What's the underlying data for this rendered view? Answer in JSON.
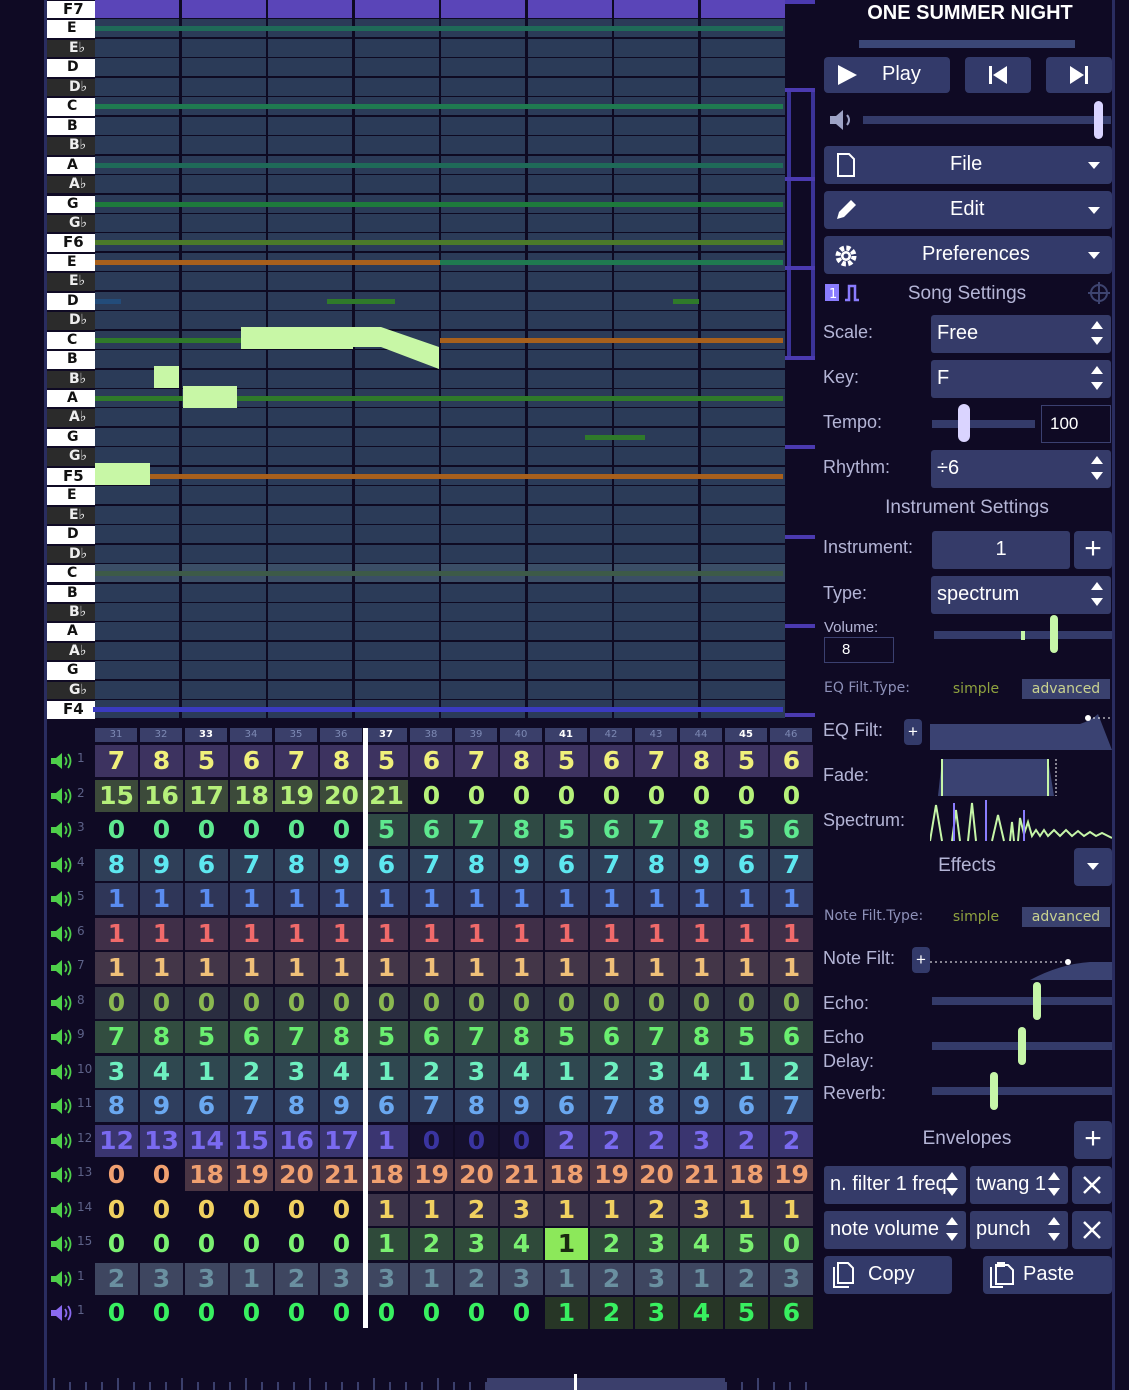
{
  "piano_keys": [
    {
      "label": "F7",
      "kind": "o"
    },
    {
      "label": "E",
      "kind": "w"
    },
    {
      "label": "E♭",
      "kind": "b"
    },
    {
      "label": "D",
      "kind": "w"
    },
    {
      "label": "D♭",
      "kind": "b"
    },
    {
      "label": "C",
      "kind": "w"
    },
    {
      "label": "B",
      "kind": "w"
    },
    {
      "label": "B♭",
      "kind": "b"
    },
    {
      "label": "A",
      "kind": "w"
    },
    {
      "label": "A♭",
      "kind": "b"
    },
    {
      "label": "G",
      "kind": "w"
    },
    {
      "label": "G♭",
      "kind": "b"
    },
    {
      "label": "F6",
      "kind": "o"
    },
    {
      "label": "E",
      "kind": "w"
    },
    {
      "label": "E♭",
      "kind": "b"
    },
    {
      "label": "D",
      "kind": "w"
    },
    {
      "label": "D♭",
      "kind": "b"
    },
    {
      "label": "C",
      "kind": "w"
    },
    {
      "label": "B",
      "kind": "w"
    },
    {
      "label": "B♭",
      "kind": "b"
    },
    {
      "label": "A",
      "kind": "w"
    },
    {
      "label": "A♭",
      "kind": "b"
    },
    {
      "label": "G",
      "kind": "w"
    },
    {
      "label": "G♭",
      "kind": "b"
    },
    {
      "label": "F5",
      "kind": "o"
    },
    {
      "label": "E",
      "kind": "w"
    },
    {
      "label": "E♭",
      "kind": "b"
    },
    {
      "label": "D",
      "kind": "w"
    },
    {
      "label": "D♭",
      "kind": "b"
    },
    {
      "label": "C",
      "kind": "w"
    },
    {
      "label": "B",
      "kind": "w"
    },
    {
      "label": "B♭",
      "kind": "b"
    },
    {
      "label": "A",
      "kind": "w"
    },
    {
      "label": "A♭",
      "kind": "b"
    },
    {
      "label": "G",
      "kind": "w"
    },
    {
      "label": "G♭",
      "kind": "b"
    },
    {
      "label": "F4",
      "kind": "o"
    }
  ],
  "bar_numbers": [
    "31",
    "32",
    "33",
    "34",
    "35",
    "36",
    "37",
    "38",
    "39",
    "40",
    "41",
    "42",
    "43",
    "44",
    "45",
    "46"
  ],
  "highlighted_bars": [
    "33",
    "37",
    "41",
    "45"
  ],
  "channels": [
    {
      "num": "1",
      "color": "#f0f07a",
      "bg": "#3d3360",
      "values": [
        "7",
        "8",
        "5",
        "6",
        "7",
        "8",
        "5",
        "6",
        "7",
        "8",
        "5",
        "6",
        "7",
        "8",
        "5",
        "6"
      ]
    },
    {
      "num": "2",
      "color": "#b5f07a",
      "bg": "#3c4a3a",
      "values": [
        "15",
        "16",
        "17",
        "18",
        "19",
        "20",
        "21",
        "0",
        "0",
        "0",
        "0",
        "0",
        "0",
        "0",
        "0",
        "0"
      ],
      "filled": 7
    },
    {
      "num": "3",
      "color": "#5ee88f",
      "bg": "#2f4a44",
      "values": [
        "0",
        "0",
        "0",
        "0",
        "0",
        "0",
        "5",
        "6",
        "7",
        "8",
        "5",
        "6",
        "7",
        "8",
        "5",
        "6"
      ],
      "filled_from": 6
    },
    {
      "num": "4",
      "color": "#5ee8f0",
      "bg": "#2f3f58",
      "values": [
        "8",
        "9",
        "6",
        "7",
        "8",
        "9",
        "6",
        "7",
        "8",
        "9",
        "6",
        "7",
        "8",
        "9",
        "6",
        "7"
      ]
    },
    {
      "num": "5",
      "color": "#5a8cf0",
      "bg": "#2f3658",
      "values": [
        "1",
        "1",
        "1",
        "1",
        "1",
        "1",
        "1",
        "1",
        "1",
        "1",
        "1",
        "1",
        "1",
        "1",
        "1",
        "1"
      ]
    },
    {
      "num": "6",
      "color": "#f06a6a",
      "bg": "#402f48",
      "values": [
        "1",
        "1",
        "1",
        "1",
        "1",
        "1",
        "1",
        "1",
        "1",
        "1",
        "1",
        "1",
        "1",
        "1",
        "1",
        "1"
      ]
    },
    {
      "num": "7",
      "color": "#f0c078",
      "bg": "#433648",
      "values": [
        "1",
        "1",
        "1",
        "1",
        "1",
        "1",
        "1",
        "1",
        "1",
        "1",
        "1",
        "1",
        "1",
        "1",
        "1",
        "1"
      ]
    },
    {
      "num": "8",
      "color": "#8ab850",
      "bg": "#2a2d40",
      "values": [
        "0",
        "0",
        "0",
        "0",
        "0",
        "0",
        "0",
        "0",
        "0",
        "0",
        "0",
        "0",
        "0",
        "0",
        "0",
        "0"
      ]
    },
    {
      "num": "9",
      "color": "#6af070",
      "bg": "#324d40",
      "values": [
        "7",
        "8",
        "5",
        "6",
        "7",
        "8",
        "5",
        "6",
        "7",
        "8",
        "5",
        "6",
        "7",
        "8",
        "5",
        "6"
      ]
    },
    {
      "num": "10",
      "color": "#6ef0c0",
      "bg": "#2f4850",
      "values": [
        "3",
        "4",
        "1",
        "2",
        "3",
        "4",
        "1",
        "2",
        "3",
        "4",
        "1",
        "2",
        "3",
        "4",
        "1",
        "2"
      ]
    },
    {
      "num": "11",
      "color": "#6aa8f0",
      "bg": "#2f3e5e",
      "values": [
        "8",
        "9",
        "6",
        "7",
        "8",
        "9",
        "6",
        "7",
        "8",
        "9",
        "6",
        "7",
        "8",
        "9",
        "6",
        "7"
      ]
    },
    {
      "num": "12",
      "color": "#7a6af0",
      "bg": "#3a3570",
      "values": [
        "12",
        "13",
        "14",
        "15",
        "16",
        "17",
        "1",
        "0",
        "0",
        "0",
        "2",
        "2",
        "2",
        "3",
        "2",
        "2"
      ],
      "dim": [
        7,
        8,
        9
      ]
    },
    {
      "num": "13",
      "color": "#f0a070",
      "bg": "#4a3544",
      "values": [
        "0",
        "0",
        "18",
        "19",
        "20",
        "21",
        "18",
        "19",
        "20",
        "21",
        "18",
        "19",
        "20",
        "21",
        "18",
        "19"
      ],
      "empty": [
        0,
        1
      ]
    },
    {
      "num": "14",
      "color": "#f0d060",
      "bg": "#3a3248",
      "values": [
        "0",
        "0",
        "0",
        "0",
        "0",
        "0",
        "1",
        "1",
        "2",
        "3",
        "1",
        "1",
        "2",
        "3",
        "1",
        "1"
      ],
      "filled_from": 6
    },
    {
      "num": "15",
      "color": "#7af070",
      "bg": "#2f4a3a",
      "values": [
        "0",
        "0",
        "0",
        "0",
        "0",
        "0",
        "1",
        "2",
        "3",
        "4",
        "1",
        "2",
        "3",
        "4",
        "5",
        "0"
      ],
      "filled_from": 6,
      "selected": 10
    },
    {
      "num": "1",
      "color": "#6a90a0",
      "bg": "#3e4660",
      "values": [
        "2",
        "3",
        "3",
        "1",
        "2",
        "3",
        "3",
        "1",
        "2",
        "3",
        "1",
        "2",
        "3",
        "1",
        "2",
        "3"
      ]
    },
    {
      "num": "1",
      "color": "#38f060",
      "bg": "#273626",
      "values": [
        "0",
        "0",
        "0",
        "0",
        "0",
        "0",
        "0",
        "0",
        "0",
        "0",
        "1",
        "2",
        "3",
        "4",
        "5",
        "6"
      ],
      "filled_from": 10,
      "mod": true
    }
  ],
  "panel": {
    "song_title": "ONE SUMMER NIGHT",
    "play_label": "Play",
    "file_label": "File",
    "edit_label": "Edit",
    "preferences_label": "Preferences",
    "song_settings_label": "Song Settings",
    "scale_label": "Scale:",
    "scale_value": "Free",
    "key_label": "Key:",
    "key_value": "F",
    "tempo_label": "Tempo:",
    "tempo_value": "100",
    "rhythm_label": "Rhythm:",
    "rhythm_value": "÷6",
    "instrument_settings_label": "Instrument Settings",
    "instrument_label": "Instrument:",
    "instrument_value": "1",
    "type_label": "Type:",
    "type_value": "spectrum",
    "volume_label": "Volume:",
    "volume_value": "8",
    "eq_filt_type_label": "EQ Filt.Type:",
    "simple_label": "simple",
    "advanced_label": "advanced",
    "eq_filt_label": "EQ Filt:",
    "fade_label": "Fade:",
    "spectrum_label": "Spectrum:",
    "effects_label": "Effects",
    "note_filt_type_label": "Note Filt.Type:",
    "note_filt_label": "Note Filt:",
    "echo_label": "Echo:",
    "echo_delay_label": "Echo\nDelay:",
    "reverb_label": "Reverb:",
    "envelopes_label": "Envelopes",
    "envelopes": [
      {
        "target": "n. filter 1 freq",
        "shape": "twang 1"
      },
      {
        "target": "note volume",
        "shape": "punch"
      }
    ],
    "copy_label": "Copy",
    "paste_label": "Paste",
    "plus_symbol": "+",
    "volume_level": 0.93,
    "tempo_level": 0.25,
    "instrument_volume_level": 0.65,
    "echo_level": 0.56,
    "echo_delay_level": 0.48,
    "reverb_level": 0.32
  }
}
